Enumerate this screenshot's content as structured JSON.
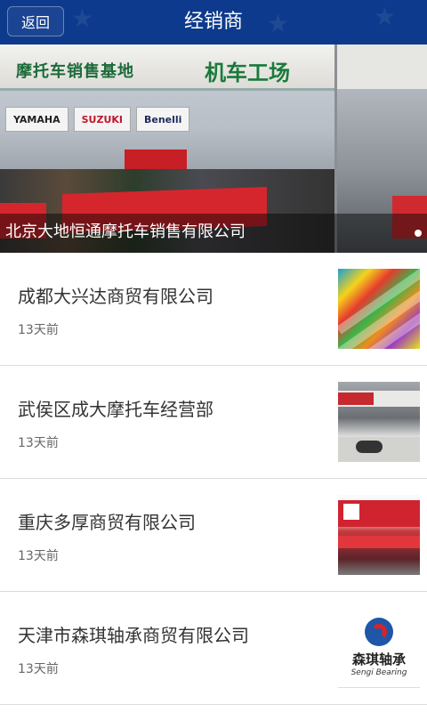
{
  "header": {
    "back_label": "返回",
    "title": "经销商"
  },
  "banner": {
    "caption": "北京大地恒通摩托车销售有限公司",
    "sign_main": "摩托车销售基地",
    "sign_right": "机车工场",
    "brands": [
      "YAMAHA",
      "SUZUKI",
      "Benelli"
    ]
  },
  "list": [
    {
      "title": "成都大兴达商贸有限公司",
      "date": "13天前",
      "thumb": "art"
    },
    {
      "title": "武侯区成大摩托车经营部",
      "date": "13天前",
      "thumb": "shop"
    },
    {
      "title": "重庆多厚商贸有限公司",
      "date": "13天前",
      "thumb": "store"
    },
    {
      "title": "天津市森琪轴承商贸有限公司",
      "date": "13天前",
      "thumb": "logo"
    }
  ],
  "logo": {
    "cn": "森琪轴承",
    "en": "Sengi Bearing"
  },
  "colors": {
    "header_bg": "#0d3a8c",
    "divider": "#dcdcdc"
  }
}
